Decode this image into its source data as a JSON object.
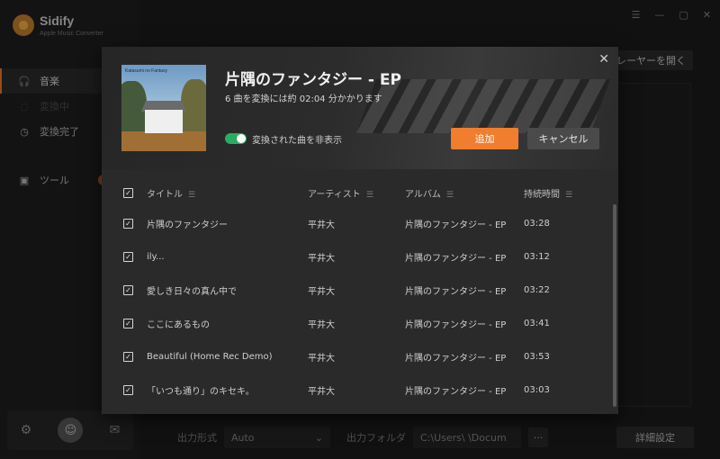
{
  "app": {
    "brand": "Sidify",
    "brand_sub": "Apple Music Converter"
  },
  "sidebar": {
    "items": [
      {
        "label": "音楽",
        "icon": "headphones-icon",
        "active": true
      },
      {
        "label": "変換中",
        "icon": "converting-icon",
        "active": false
      },
      {
        "label": "変換完了",
        "icon": "clock-icon",
        "active": false
      },
      {
        "label": "ツール",
        "icon": "toolbox-icon",
        "active": false
      }
    ]
  },
  "window_controls": [
    "☰",
    "—",
    "▢",
    "✕"
  ],
  "header": {
    "open_player_label": "プレーヤーを開く"
  },
  "bottom_bar": {
    "format_label": "出力形式",
    "format_value": "Auto",
    "folder_label": "出力フォルダ",
    "folder_value": "C:\\Users\\         \\Docum",
    "browse_label": "···",
    "detail_label": "詳細設定"
  },
  "modal": {
    "album_title": "片隅のファンタジー - EP",
    "subtitle": "6 曲を変換には約 02:04 分かかります",
    "toggle_label": "変換された曲を非表示",
    "toggle_on": true,
    "add_label": "追加",
    "cancel_label": "キャンセル",
    "cover_caption": "Katasumi no Fantasy",
    "columns": {
      "title": "タイトル",
      "artist": "アーティスト",
      "album": "アルバム",
      "duration": "持続時間"
    },
    "tracks": [
      {
        "title": "片隅のファンタジー",
        "artist": "平井大",
        "album": "片隅のファンタジー - EP",
        "duration": "03:28"
      },
      {
        "title": "ily...",
        "artist": "平井大",
        "album": "片隅のファンタジー - EP",
        "duration": "03:12"
      },
      {
        "title": "愛しき日々の真ん中で",
        "artist": "平井大",
        "album": "片隅のファンタジー - EP",
        "duration": "03:22"
      },
      {
        "title": "ここにあるもの",
        "artist": "平井大",
        "album": "片隅のファンタジー - EP",
        "duration": "03:41"
      },
      {
        "title": "Beautiful (Home Rec Demo)",
        "artist": "平井大",
        "album": "片隅のファンタジー - EP",
        "duration": "03:53"
      },
      {
        "title": "「いつも通り」のキセキ。",
        "artist": "平井大",
        "album": "片隅のファンタジー - EP",
        "duration": "03:03"
      }
    ]
  },
  "colors": {
    "accent": "#f07e2e",
    "toggle_on": "#27ae60"
  }
}
